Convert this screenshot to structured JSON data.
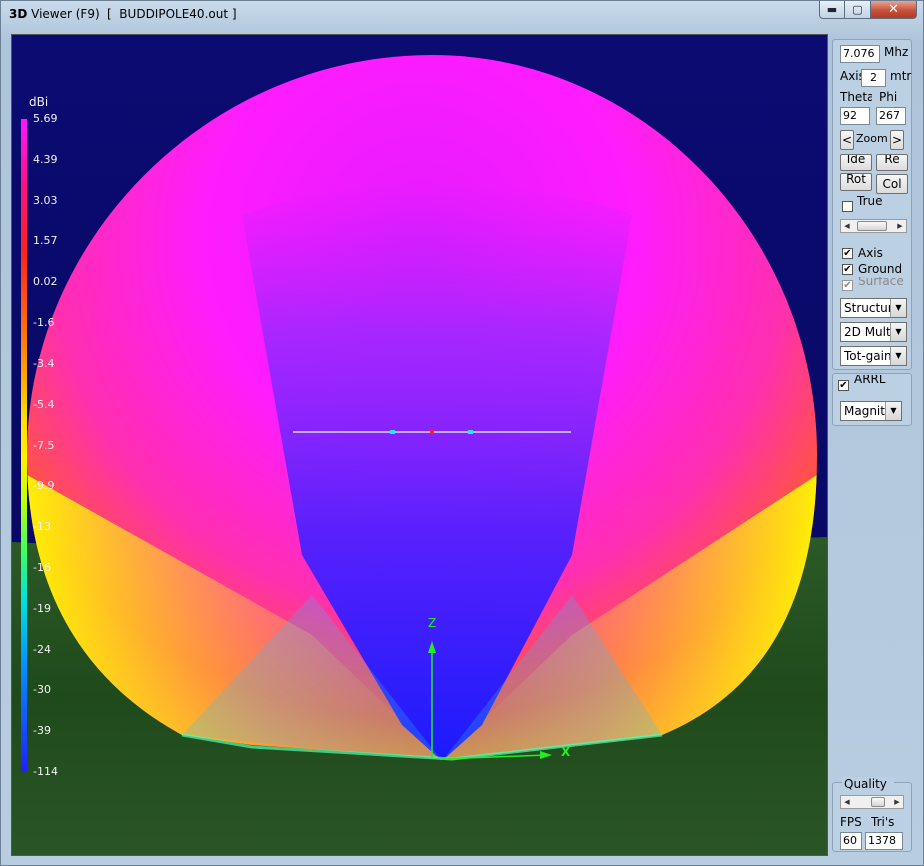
{
  "window": {
    "app_title_prefix": "3D",
    "app_title": "Viewer (F9)",
    "file_title": "[  BUDDIPOLE40.out ]",
    "min_label": "▬",
    "max_label": "▢",
    "close_label": "✕"
  },
  "legend": {
    "unit": "dBi",
    "ticks": [
      "5.69",
      "4.39",
      "3.03",
      "1.57",
      "0.02",
      "-1.6",
      "-3.4",
      "-5.4",
      "-7.5",
      "-9.9",
      "-13",
      "-16",
      "-19",
      "-24",
      "-30",
      "-39",
      "-114"
    ]
  },
  "axes": {
    "z_label": "Z",
    "x_label": "X"
  },
  "panel": {
    "freq_value": "7.076",
    "freq_unit": "Mhz",
    "axis_label": "Axis",
    "axis_value": "2",
    "axis_unit": "mtr",
    "theta_label": "Theta",
    "phi_label": "Phi",
    "theta_value": "92",
    "phi_value": "267",
    "zoom_left": "<",
    "zoom_label": "Zoom",
    "zoom_right": ">",
    "btn_a": "Ide",
    "btn_b": "Re",
    "btn_c": "Rot",
    "btn_col": "Col",
    "true_label": "True",
    "axis_check_label": "Axis",
    "ground_check_label": "Ground",
    "surface_check_label": "Surface",
    "select_structure": "Structure",
    "select_mode": "2D Mult",
    "select_gain": "Tot-gain",
    "arrl_label": "ARRL",
    "select_magnitude": "Magnit",
    "quality_label": "Quality",
    "fps_label": "FPS",
    "tris_label": "Tri's",
    "fps_value": "60",
    "tris_value": "1378"
  }
}
